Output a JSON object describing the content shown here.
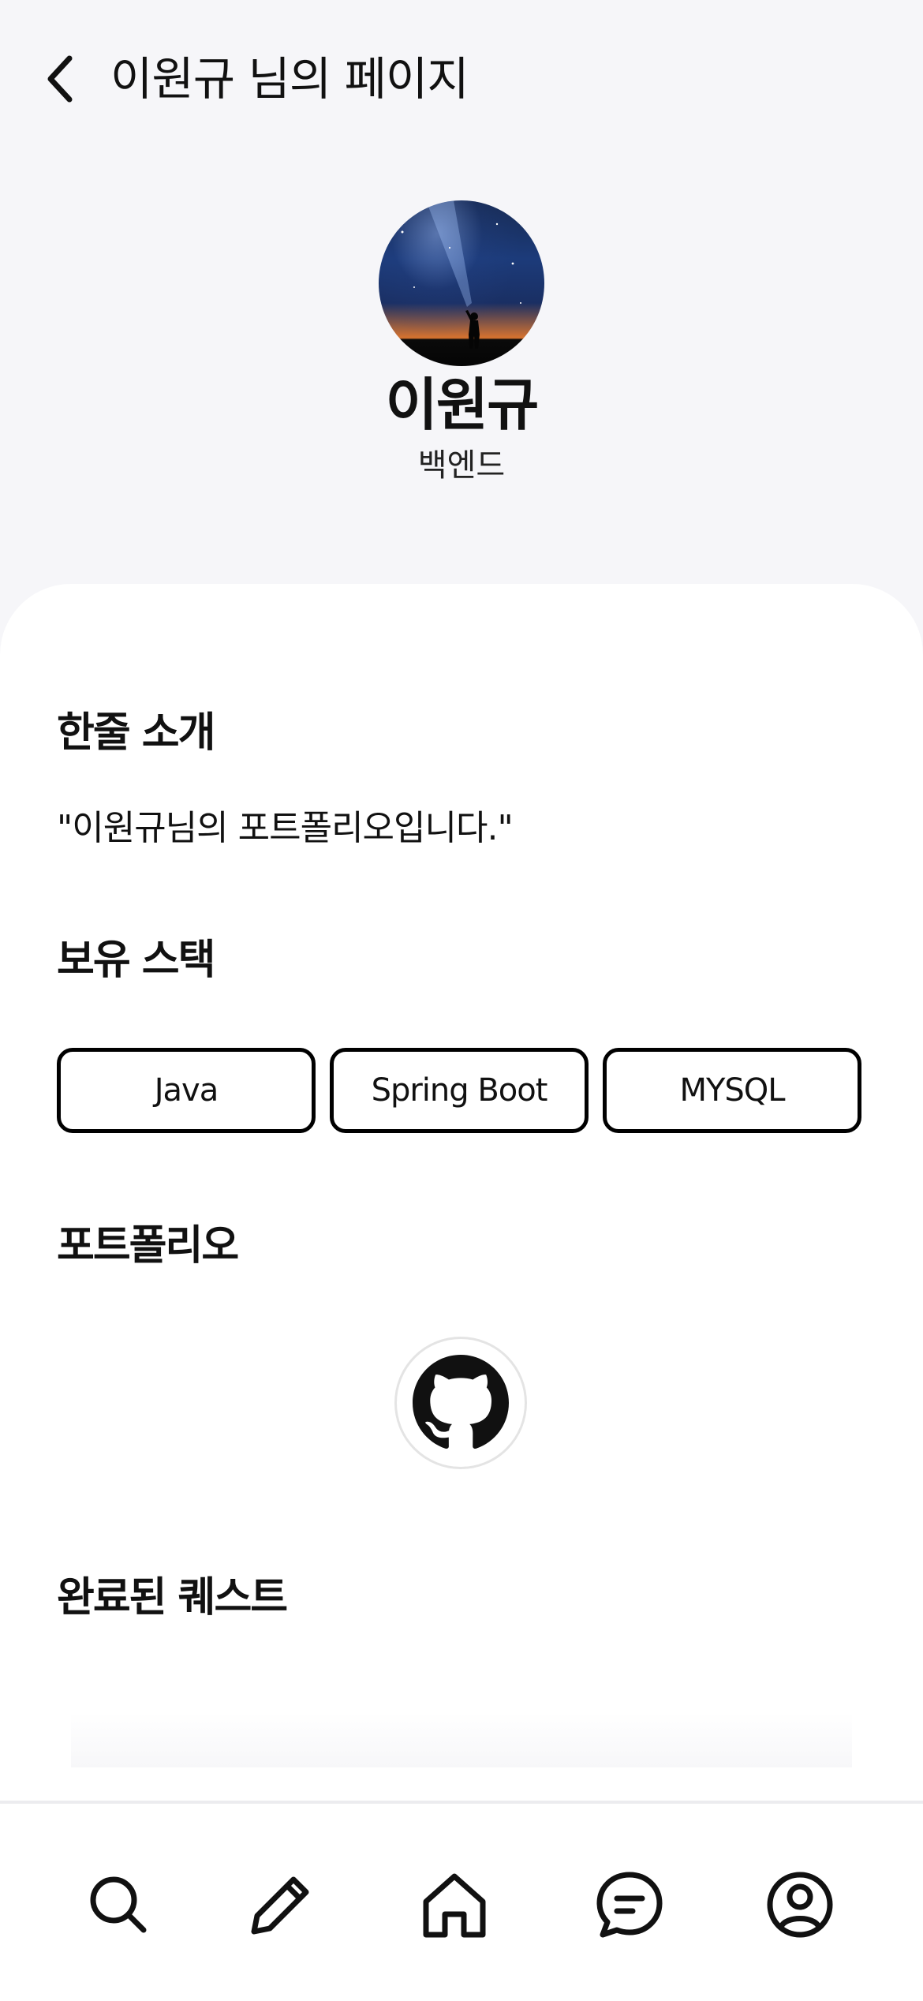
{
  "header": {
    "back_icon": "chevron-left-icon",
    "title": "이원규 님의 페이지"
  },
  "profile": {
    "avatar_image": "night sky with person pointing flashlight",
    "name": "이원규",
    "role": "백엔드"
  },
  "sections": {
    "intro": {
      "title": "한줄 소개",
      "text": "\"이원규님의 포트폴리오입니다.\""
    },
    "stack": {
      "title": "보유 스택",
      "items": [
        "Java",
        "Spring Boot",
        "MYSQL"
      ]
    },
    "portfolio": {
      "title": "포트폴리오",
      "link_icon": "github-icon"
    },
    "quests": {
      "title": "완료된 퀘스트"
    }
  },
  "tabbar": {
    "items": [
      {
        "icon": "search-icon"
      },
      {
        "icon": "pencil-icon"
      },
      {
        "icon": "home-icon"
      },
      {
        "icon": "chat-icon"
      },
      {
        "icon": "profile-icon"
      }
    ]
  },
  "colors": {
    "background": "#f6f6f9",
    "card": "#ffffff",
    "text": "#111111",
    "chip_border": "#000000"
  }
}
